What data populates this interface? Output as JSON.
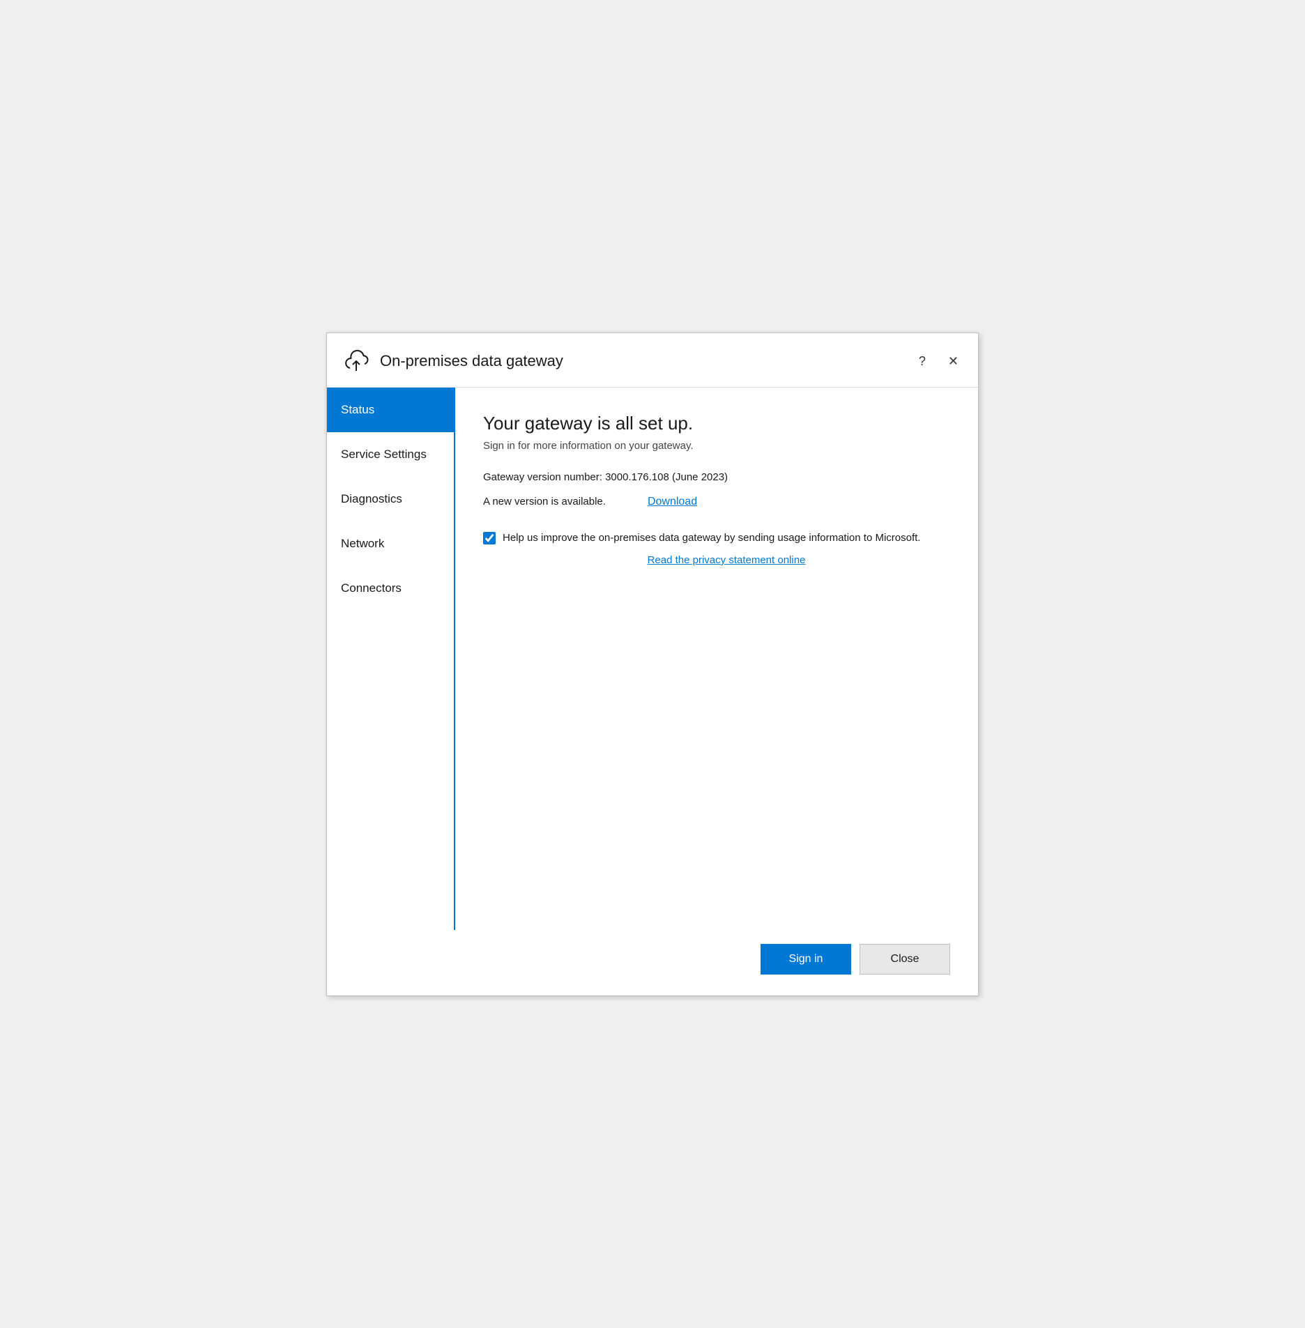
{
  "window": {
    "title": "On-premises data gateway",
    "help_btn": "?",
    "close_btn": "✕"
  },
  "sidebar": {
    "items": [
      {
        "id": "status",
        "label": "Status",
        "active": true
      },
      {
        "id": "service-settings",
        "label": "Service Settings",
        "active": false
      },
      {
        "id": "diagnostics",
        "label": "Diagnostics",
        "active": false
      },
      {
        "id": "network",
        "label": "Network",
        "active": false
      },
      {
        "id": "connectors",
        "label": "Connectors",
        "active": false
      }
    ]
  },
  "main": {
    "heading": "Your gateway is all set up.",
    "subtitle": "Sign in for more information on your gateway.",
    "version_label": "Gateway version number: 3000.176.108 (June 2023)",
    "update_text": "A new version is available.",
    "download_label": "Download",
    "checkbox_label": "Help us improve the on-premises data gateway by sending usage information to Microsoft.",
    "privacy_link_label": "Read the privacy statement online"
  },
  "footer": {
    "signin_label": "Sign in",
    "close_label": "Close"
  },
  "colors": {
    "accent": "#0078d4",
    "active_sidebar_bg": "#0078d4",
    "active_sidebar_text": "#ffffff"
  }
}
